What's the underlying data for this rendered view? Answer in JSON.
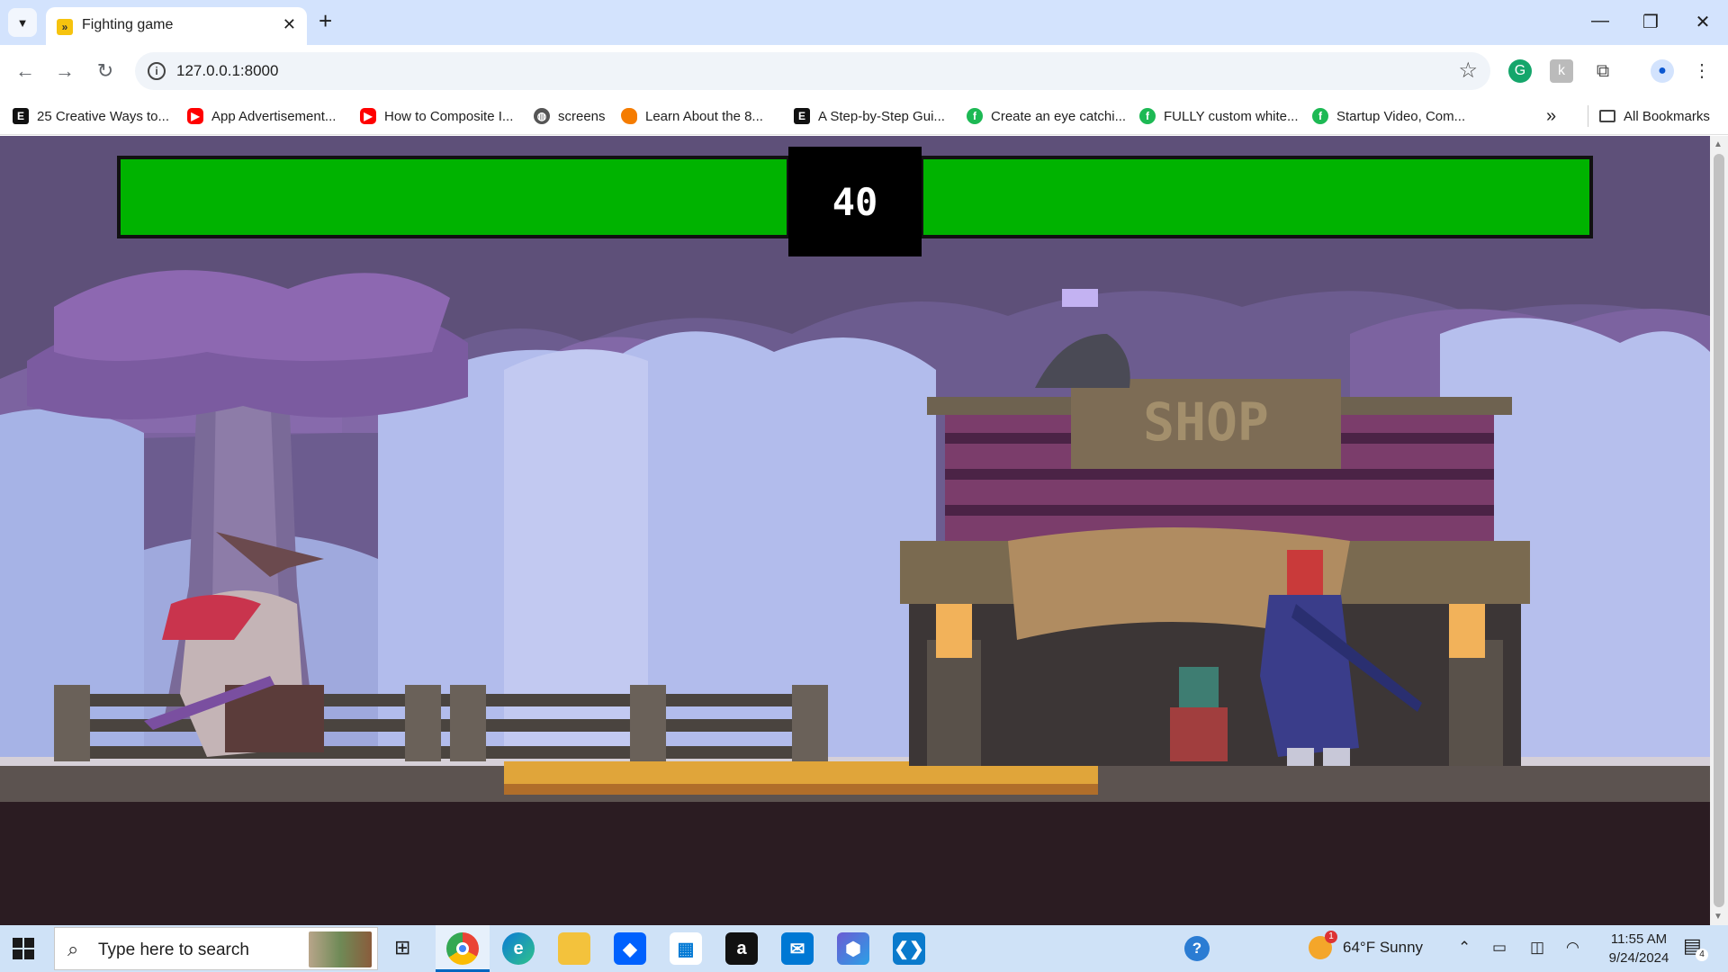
{
  "browser": {
    "tab": {
      "title": "Fighting game",
      "close": "✕"
    },
    "new_tab": "+",
    "window_controls": {
      "minimize": "—",
      "restore": "❐",
      "close": "✕"
    },
    "url": "127.0.0.1:8000",
    "bookmarks": [
      {
        "label": "25 Creative Ways to...",
        "icon": "e-icon"
      },
      {
        "label": "App Advertisement...",
        "icon": "youtube-icon"
      },
      {
        "label": "How to Composite I...",
        "icon": "youtube-icon"
      },
      {
        "label": "screens",
        "icon": "globe-icon"
      },
      {
        "label": "Learn About the 8...",
        "icon": "orange-icon"
      },
      {
        "label": "A Step-by-Step Gui...",
        "icon": "e-icon"
      },
      {
        "label": "Create an eye catchi...",
        "icon": "green-icon"
      },
      {
        "label": "FULLY custom white...",
        "icon": "green-icon"
      },
      {
        "label": "Startup Video, Com...",
        "icon": "green-icon"
      }
    ],
    "more_bookmarks": "»",
    "all_bookmarks": "All Bookmarks"
  },
  "game": {
    "timer": "40",
    "player_health_percent": 100,
    "enemy_health_percent": 100,
    "shop_sign": "SHOP",
    "colors": {
      "health": "#00b300",
      "timer_bg": "#000000"
    }
  },
  "taskbar": {
    "search_placeholder": "Type here to search",
    "weather": "64°F  Sunny",
    "weather_badge": "1",
    "time": "11:55 AM",
    "date": "9/24/2024",
    "notifications": "4"
  }
}
